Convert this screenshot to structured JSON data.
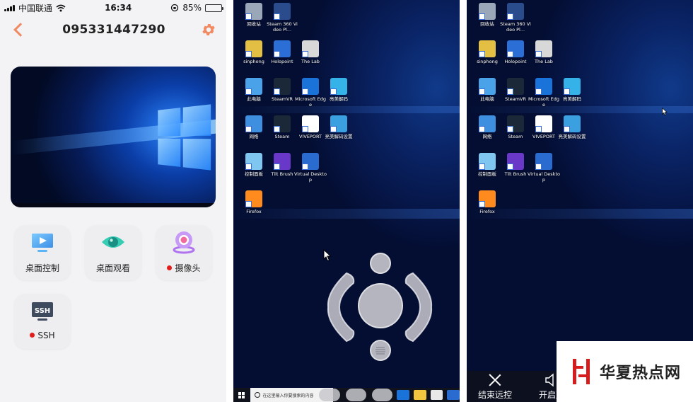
{
  "phone": {
    "status": {
      "carrier": "中国联通",
      "time": "16:34",
      "battery": "85%",
      "battery_fraction": 0.85
    },
    "nav": {
      "title": "095331447290"
    },
    "features": [
      {
        "label": "桌面控制",
        "icon": "desktop-control-icon",
        "status_dot": false
      },
      {
        "label": "桌面观看",
        "icon": "eye-icon",
        "status_dot": false
      },
      {
        "label": "摄像头",
        "icon": "camera-icon",
        "status_dot": true
      },
      {
        "label": "SSH",
        "icon": "ssh-icon",
        "icon_text": "SSH",
        "status_dot": true
      }
    ]
  },
  "desktop_middle": {
    "icons": [
      {
        "label": "回收站",
        "color": "#9aa7b8"
      },
      {
        "label": "Steam 360 Video Pl...",
        "color": "#2a4b8c"
      },
      {
        "label": "sinphong",
        "color": "#e3c043"
      },
      {
        "label": "Holopoint",
        "color": "#2b6fd6"
      },
      {
        "label": "The Lab",
        "color": "#d8d8d8"
      },
      {
        "label": "此电脑",
        "color": "#4aa3e8"
      },
      {
        "label": "SteamVR",
        "color": "#1b2838"
      },
      {
        "label": "Microsoft Edge",
        "color": "#1a73d9"
      },
      {
        "label": "亮美解码",
        "color": "#35b3e8"
      },
      {
        "label": "网络",
        "color": "#3f8fe0"
      },
      {
        "label": "Steam",
        "color": "#1b2838"
      },
      {
        "label": "VIVEPORT",
        "color": "#ffffff"
      },
      {
        "label": "亮美解码设置",
        "color": "#3aa0e0"
      },
      {
        "label": "控制面板",
        "color": "#7fc6f0"
      },
      {
        "label": "Tilt Brush",
        "color": "#6a38c8"
      },
      {
        "label": "Virtual Desktop",
        "color": "#2a6bd0"
      },
      {
        "label": "Firefox",
        "color": "#ff8a1e"
      }
    ],
    "taskbar": {
      "search_placeholder": "在这里输入你要搜索的内容"
    }
  },
  "desktop_right": {
    "icons": [
      {
        "label": "回收站",
        "color": "#9aa7b8"
      },
      {
        "label": "Steam 360 Video Pl...",
        "color": "#2a4b8c"
      },
      {
        "label": "sinphong",
        "color": "#e3c043"
      },
      {
        "label": "Holopoint",
        "color": "#2b6fd6"
      },
      {
        "label": "The Lab",
        "color": "#d8d8d8"
      },
      {
        "label": "此电脑",
        "color": "#4aa3e8"
      },
      {
        "label": "SteamVR",
        "color": "#1b2838"
      },
      {
        "label": "Microsoft Edge",
        "color": "#1a73d9"
      },
      {
        "label": "亮美解码",
        "color": "#35b3e8"
      },
      {
        "label": "网络",
        "color": "#3f8fe0"
      },
      {
        "label": "Steam",
        "color": "#1b2838"
      },
      {
        "label": "VIVEPORT",
        "color": "#ffffff"
      },
      {
        "label": "亮美解码设置",
        "color": "#3aa0e0"
      },
      {
        "label": "控制面板",
        "color": "#7fc6f0"
      },
      {
        "label": "Tilt Brush",
        "color": "#6a38c8"
      },
      {
        "label": "Virtual Desktop",
        "color": "#2a6bd0"
      },
      {
        "label": "Firefox",
        "color": "#ff8a1e"
      }
    ],
    "bottom_bar": {
      "end_remote": "结束远控",
      "open_sound": "开启声"
    }
  },
  "watermark": {
    "text": "华夏热点网"
  },
  "colors": {
    "accent": "#f08a62",
    "status_dot": "#e21b1b"
  }
}
